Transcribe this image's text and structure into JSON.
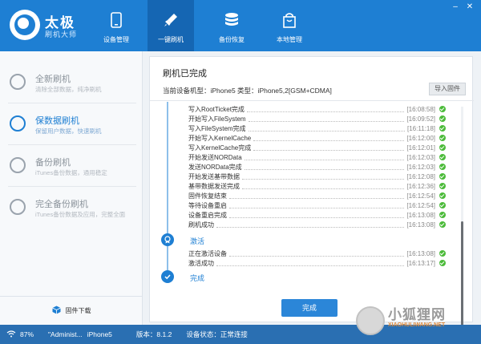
{
  "app": {
    "brand_title": "太极",
    "brand_subtitle": "刷机大师"
  },
  "nav": [
    {
      "label": "设备管理",
      "icon": "phone-icon"
    },
    {
      "label": "一键刷机",
      "icon": "rocket-icon"
    },
    {
      "label": "备份恢复",
      "icon": "database-icon"
    },
    {
      "label": "本地管理",
      "icon": "bag-icon"
    }
  ],
  "sidebar": {
    "items": [
      {
        "title": "全新刷机",
        "subtitle": "清除全部数据，纯净刷机"
      },
      {
        "title": "保数据刷机",
        "subtitle": "保留用户数据，快速刷机"
      },
      {
        "title": "备份刷机",
        "subtitle": "iTunes备份数据，通用稳定"
      },
      {
        "title": "完全备份刷机",
        "subtitle": "iTunes备份数据及应用，完整全面"
      }
    ],
    "firmware_download": "固件下载"
  },
  "panel": {
    "title": "刷机已完成",
    "device_line": "当前设备机型：iPhone5 类型：iPhone5,2[GSM+CDMA]",
    "import_button": "导入固件",
    "logs_flash": [
      {
        "text": "写入RootTicket完成",
        "time": "[16:08:58]"
      },
      {
        "text": "开始写入FileSystem",
        "time": "[16:09:52]"
      },
      {
        "text": "写入FileSystem完成",
        "time": "[16:11:18]"
      },
      {
        "text": "开始写入KernelCache",
        "time": "[16:12:00]"
      },
      {
        "text": "写入KernelCache完成",
        "time": "[16:12:01]"
      },
      {
        "text": "开始发送NORData",
        "time": "[16:12:03]"
      },
      {
        "text": "发送NORData完成",
        "time": "[16:12:03]"
      },
      {
        "text": "开始发送基带数据",
        "time": "[16:12:08]"
      },
      {
        "text": "基带数据发送完成",
        "time": "[16:12:36]"
      },
      {
        "text": "固件恢复结束",
        "time": "[16:12:54]"
      },
      {
        "text": "等待设备重启",
        "time": "[16:12:54]"
      },
      {
        "text": "设备重启完成",
        "time": "[16:13:08]"
      },
      {
        "text": "刷机成功",
        "time": "[16:13:08]"
      }
    ],
    "stage_activate": "激活",
    "logs_activate": [
      {
        "text": "正在激活设备",
        "time": "[16:13:08]"
      },
      {
        "text": "激活成功",
        "time": "[16:13:17]"
      }
    ],
    "stage_done": "完成",
    "done_button": "完成"
  },
  "statusbar": {
    "zoom": "87%",
    "user": "\"Administ...",
    "device": "iPhone5",
    "version": "版本：8.1.2",
    "device_status": "设备状态：正常连接"
  },
  "watermark": {
    "text": "小狐狸网",
    "url": "XIAOHULIWANG.NET"
  },
  "colors": {
    "primary": "#1e7fd3",
    "success": "#4cbb3a"
  }
}
